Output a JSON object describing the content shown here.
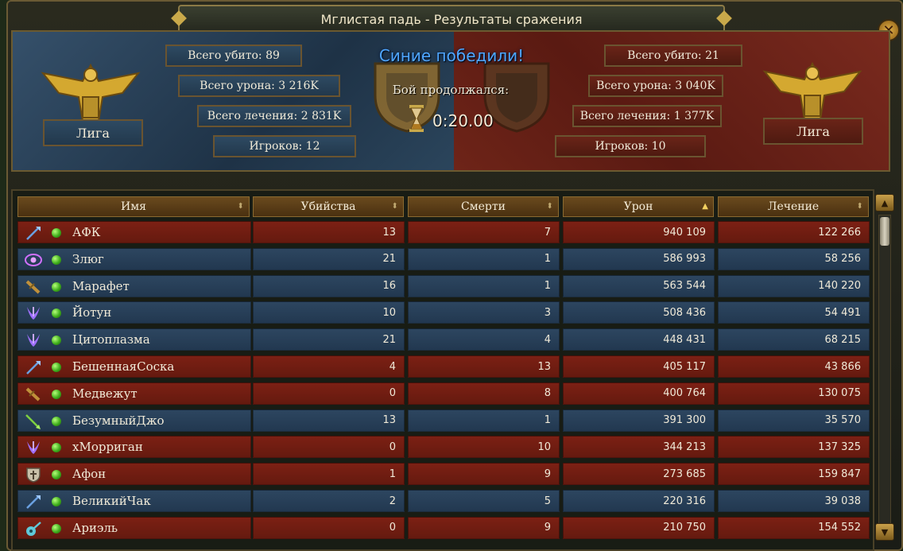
{
  "window": {
    "title": "Мглистая падь - Результаты сражения",
    "close_label": "✕"
  },
  "result": {
    "winner_text": "Синие победили!",
    "duration_label": "Бой продолжался:",
    "duration": "0:20.00"
  },
  "blue_team": {
    "league": "Лига",
    "total_kills": "Всего убито: 89",
    "total_damage": "Всего урона: 3 216K",
    "total_healing": "Всего лечения: 2 831K",
    "players": "Игроков: 12"
  },
  "red_team": {
    "league": "Лига",
    "total_kills": "Всего убито: 21",
    "total_damage": "Всего урона: 3 040K",
    "total_healing": "Всего лечения: 1 377K",
    "players": "Игроков: 10"
  },
  "table": {
    "headers": [
      "Имя",
      "Убийства",
      "Смерти",
      "Урон",
      "Лечение"
    ],
    "sorted_column": "Урон",
    "rows": [
      {
        "team": "red",
        "class_icon": "staff-icon",
        "name": "АФК",
        "kills": "13",
        "deaths": "7",
        "damage": "940 109",
        "healing": "122 266"
      },
      {
        "team": "blue",
        "class_icon": "eye-icon",
        "name": "Злюг",
        "kills": "21",
        "deaths": "1",
        "damage": "586 993",
        "healing": "58 256"
      },
      {
        "team": "blue",
        "class_icon": "sword-icon",
        "name": "Марафет",
        "kills": "16",
        "deaths": "1",
        "damage": "563 544",
        "healing": "140 220"
      },
      {
        "team": "blue",
        "class_icon": "claw-icon",
        "name": "Йотун",
        "kills": "10",
        "deaths": "3",
        "damage": "508 436",
        "healing": "54 491"
      },
      {
        "team": "blue",
        "class_icon": "claw-icon",
        "name": "Цитоплазма",
        "kills": "21",
        "deaths": "4",
        "damage": "448 431",
        "healing": "68 215"
      },
      {
        "team": "red",
        "class_icon": "staff-icon",
        "name": "БешеннаяСоска",
        "kills": "4",
        "deaths": "13",
        "damage": "405 117",
        "healing": "43 866"
      },
      {
        "team": "red",
        "class_icon": "sword-icon",
        "name": "Медвежут",
        "kills": "0",
        "deaths": "8",
        "damage": "400 764",
        "healing": "130 075"
      },
      {
        "team": "blue",
        "class_icon": "arrow-icon",
        "name": "БезумныйДжо",
        "kills": "13",
        "deaths": "1",
        "damage": "391 300",
        "healing": "35 570"
      },
      {
        "team": "red",
        "class_icon": "claw-icon",
        "name": "хМорриган",
        "kills": "0",
        "deaths": "10",
        "damage": "344 213",
        "healing": "137 325"
      },
      {
        "team": "red",
        "class_icon": "shield-icon",
        "name": "Афон",
        "kills": "1",
        "deaths": "9",
        "damage": "273 685",
        "healing": "159 847"
      },
      {
        "team": "blue",
        "class_icon": "staff-icon",
        "name": "ВеликийЧак",
        "kills": "2",
        "deaths": "5",
        "damage": "220 316",
        "healing": "39 038"
      },
      {
        "team": "red",
        "class_icon": "lute-icon",
        "name": "Ариэль",
        "kills": "0",
        "deaths": "9",
        "damage": "210 750",
        "healing": "154 552"
      }
    ]
  },
  "colors": {
    "blue_row": "#2d4660",
    "red_row": "#7c2014",
    "winner_text": "#4fa6ff",
    "gold": "#c9a94a"
  }
}
